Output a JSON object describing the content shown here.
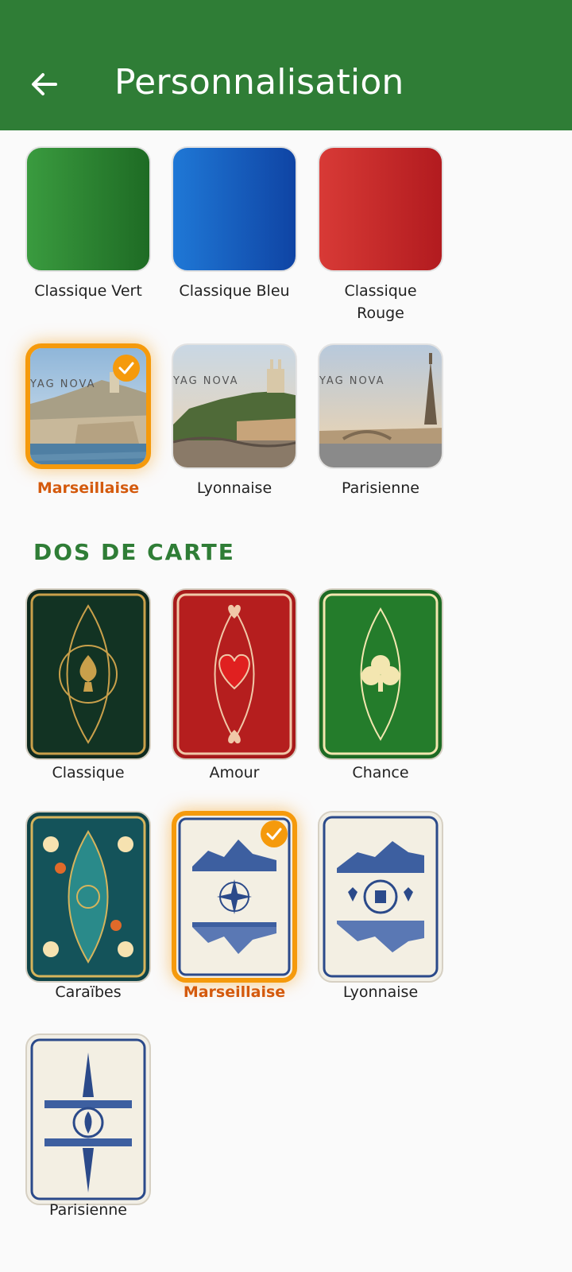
{
  "header": {
    "title": "Personnalisation"
  },
  "backgrounds": [
    {
      "label": "Classique Vert",
      "color_start": "#3a9b3f",
      "color_end": "#1e6b24",
      "selected": false
    },
    {
      "label": "Classique Bleu",
      "color_start": "#1f78d6",
      "color_end": "#0f44a4",
      "selected": false
    },
    {
      "label": "Classique Rouge",
      "color_start": "#d83a36",
      "color_end": "#b21b1f",
      "selected": false
    },
    {
      "label": "Marseillaise",
      "watermark": "YAG NOVA",
      "selected": true
    },
    {
      "label": "Lyonnaise",
      "watermark": "YAG NOVA",
      "selected": false
    },
    {
      "label": "Parisienne",
      "watermark": "YAG NOVA",
      "selected": false
    }
  ],
  "card_back_section": {
    "title": "DOS DE CARTE"
  },
  "card_backs": [
    {
      "label": "Classique",
      "selected": false
    },
    {
      "label": "Amour",
      "selected": false
    },
    {
      "label": "Chance",
      "selected": false
    },
    {
      "label": "Caraïbes",
      "selected": false
    },
    {
      "label": "Marseillaise",
      "selected": true
    },
    {
      "label": "Lyonnaise",
      "selected": false
    },
    {
      "label": "Parisienne",
      "selected": false
    }
  ],
  "colors": {
    "app_bar": "#2f7d36",
    "selected_accent": "#f59a0c",
    "selected_text": "#d45a0d"
  }
}
